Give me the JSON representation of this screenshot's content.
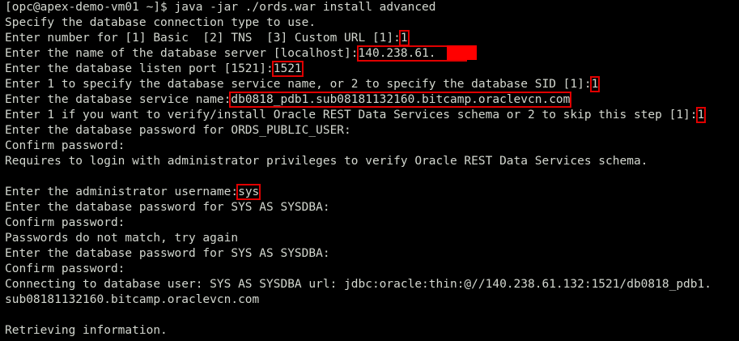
{
  "terminal": {
    "lines": [
      {
        "text": "[opc@apex-demo-vm01 ~]$ java -jar ./ords.war install advanced"
      },
      {
        "text": "Specify the database connection type to use."
      },
      {
        "prompt": "Enter number for [1] Basic  [2] TNS  [3] Custom URL [1]:",
        "answer": "1"
      },
      {
        "prompt": "Enter the name of the database server [localhost]:",
        "answer": "140.238.61."
      },
      {
        "prompt": "Enter the database listen port [1521]:",
        "answer": "1521"
      },
      {
        "prompt": "Enter 1 to specify the database service name, or 2 to specify the database SID [1]:",
        "answer": "1"
      },
      {
        "prompt": "Enter the database service name:",
        "answer": "db0818_pdb1.sub08181132160.bitcamp.oraclevcn.com"
      },
      {
        "prompt": "Enter 1 if you want to verify/install Oracle REST Data Services schema or 2 to skip this step [1]:",
        "answer": "1"
      },
      {
        "text": "Enter the database password for ORDS_PUBLIC_USER:"
      },
      {
        "text": "Confirm password:"
      },
      {
        "text": "Requires to login with administrator privileges to verify Oracle REST Data Services schema."
      },
      {
        "text": ""
      },
      {
        "prompt": "Enter the administrator username:",
        "answer": "sys"
      },
      {
        "text": "Enter the database password for SYS AS SYSDBA:"
      },
      {
        "text": "Confirm password:"
      },
      {
        "text": "Passwords do not match, try again"
      },
      {
        "text": "Enter the database password for SYS AS SYSDBA:"
      },
      {
        "text": "Confirm password:"
      },
      {
        "text": "Connecting to database user: SYS AS SYSDBA url: jdbc:oracle:thin:@//140.238.61.132:1521/db0818_pdb1."
      },
      {
        "text": "sub08181132160.bitcamp.oraclevcn.com"
      },
      {
        "text": ""
      },
      {
        "text": "Retrieving information."
      }
    ]
  },
  "colors": {
    "background": "#000000",
    "foreground": "#d3d7cf",
    "highlight_box": "#e00000",
    "redaction": "#ff0000"
  }
}
